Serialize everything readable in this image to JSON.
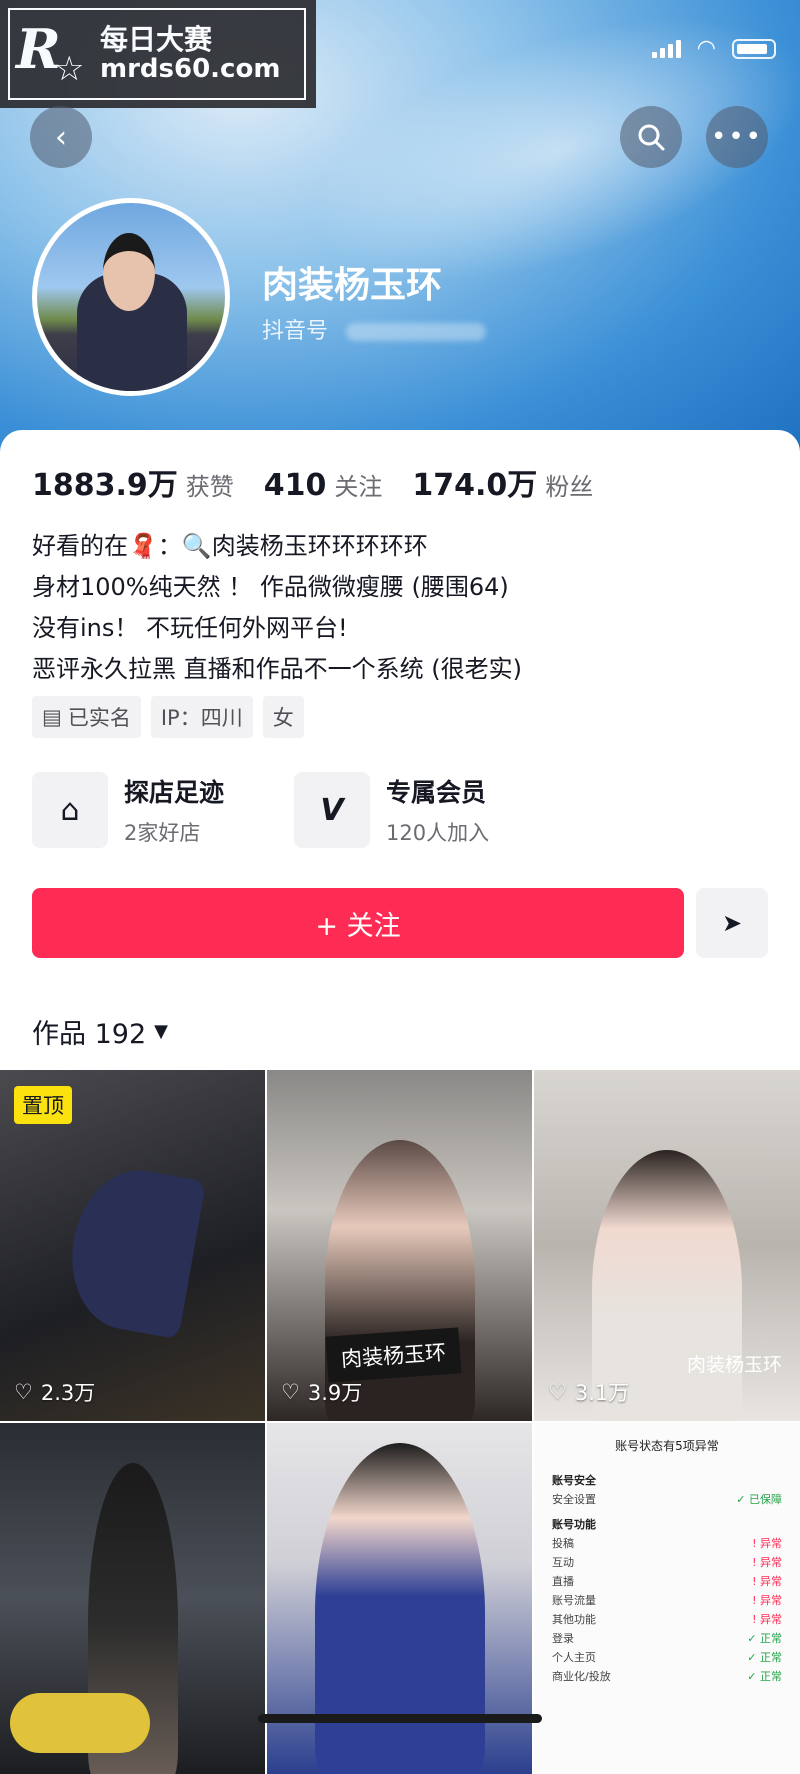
{
  "watermark": {
    "logo": "R",
    "line1": "每日大赛",
    "line2": "mrds60.com"
  },
  "profile": {
    "name": "肉装杨玉环",
    "douyin_id_label": "抖音号"
  },
  "stats": [
    {
      "num": "1883.9万",
      "label": "获赞"
    },
    {
      "num": "410",
      "label": "关注"
    },
    {
      "num": "174.0万",
      "label": "粉丝"
    }
  ],
  "bio": [
    "好看的在🧣：🔍肉装杨玉环环环环环",
    "身材100%纯天然 ！ 作品微微瘦腰 (腰围64)",
    "没有ins！ 不玩任何外网平台!",
    "恶评永久拉黑 直播和作品不一个系统 (很老实)"
  ],
  "tags": {
    "verified": "已实名",
    "ip": "IP：四川",
    "gender": "女"
  },
  "features": {
    "shop": {
      "title": "探店足迹",
      "sub": "2家好店"
    },
    "member": {
      "title": "专属会员",
      "sub": "120人加入"
    }
  },
  "actions": {
    "follow": "+ 关注"
  },
  "works": {
    "label": "作品 192"
  },
  "grid": {
    "pinned": "置顶",
    "likes": [
      "2.3万",
      "3.9万",
      "3.1万"
    ],
    "caption_2": "肉装杨玉环",
    "caption_3": "肉装杨玉环",
    "doc": {
      "title": "账号状态有5项异常",
      "sec1": "账号安全",
      "r1": [
        "安全设置",
        "✓ 已保障"
      ],
      "sec2": "账号功能",
      "rows": [
        [
          "投稿",
          "! 异常"
        ],
        [
          "互动",
          "! 异常"
        ],
        [
          "直播",
          "! 异常"
        ],
        [
          "账号流量",
          "! 异常"
        ],
        [
          "其他功能",
          "! 异常"
        ],
        [
          "登录",
          "✓ 正常"
        ],
        [
          "个人主页",
          "✓ 正常"
        ],
        [
          "商业化/投放",
          "✓ 正常"
        ]
      ]
    }
  },
  "colors": {
    "primary": "#fe2c55",
    "pin": "#fbe10e",
    "hero": "#3a8fd6"
  }
}
